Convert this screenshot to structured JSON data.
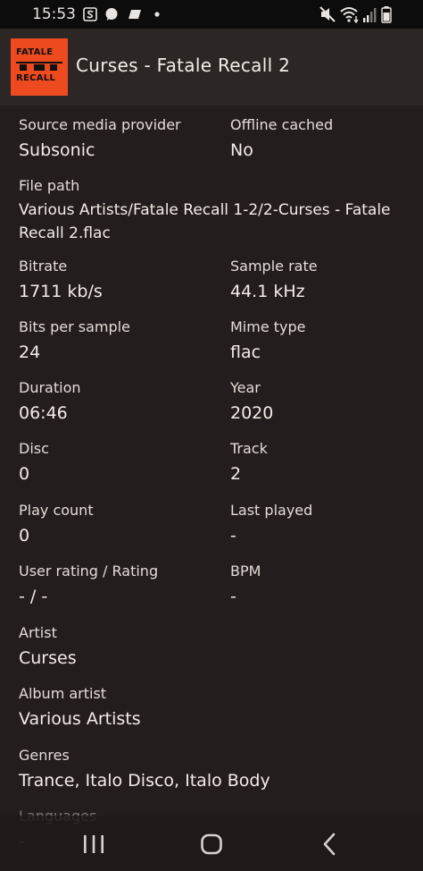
{
  "status_bar": {
    "time": "15:53",
    "notification_icons": [
      "s-app-icon",
      "chat-bubble-icon",
      "tag-icon",
      "dot-icon"
    ],
    "system_icons": [
      "mute-icon",
      "wifi-icon",
      "signal-icon",
      "battery-icon"
    ]
  },
  "header": {
    "title": "Curses - Fatale Recall 2",
    "album_art_text": [
      "FATALE",
      "RECALL"
    ],
    "album_art_color": "#ee4a1f"
  },
  "fields": {
    "source_media_provider": {
      "label": "Source media provider",
      "value": "Subsonic"
    },
    "offline_cached": {
      "label": "Offline cached",
      "value": "No"
    },
    "file_path": {
      "label": "File path",
      "value": "Various Artists/Fatale Recall 1-2/2-Curses - Fatale Recall 2.flac"
    },
    "bitrate": {
      "label": "Bitrate",
      "value": "1711 kb/s"
    },
    "sample_rate": {
      "label": "Sample rate",
      "value": "44.1 kHz"
    },
    "bits_per_sample": {
      "label": "Bits per sample",
      "value": "24"
    },
    "mime_type": {
      "label": "Mime type",
      "value": "flac"
    },
    "duration": {
      "label": "Duration",
      "value": "06:46"
    },
    "year": {
      "label": "Year",
      "value": "2020"
    },
    "disc": {
      "label": "Disc",
      "value": "0"
    },
    "track": {
      "label": "Track",
      "value": "2"
    },
    "play_count": {
      "label": "Play count",
      "value": "0"
    },
    "last_played": {
      "label": "Last played",
      "value": "-"
    },
    "user_rating": {
      "label": "User rating / Rating",
      "value": "- / -"
    },
    "bpm": {
      "label": "BPM",
      "value": "-"
    },
    "artist": {
      "label": "Artist",
      "value": "Curses"
    },
    "album_artist": {
      "label": "Album artist",
      "value": "Various Artists"
    },
    "genres": {
      "label": "Genres",
      "value": "Trance, Italo Disco, Italo Body"
    },
    "languages": {
      "label": "Languages",
      "value": "-"
    }
  },
  "nav_bar": {
    "buttons": [
      "recent-apps-icon",
      "home-icon",
      "back-icon"
    ]
  }
}
